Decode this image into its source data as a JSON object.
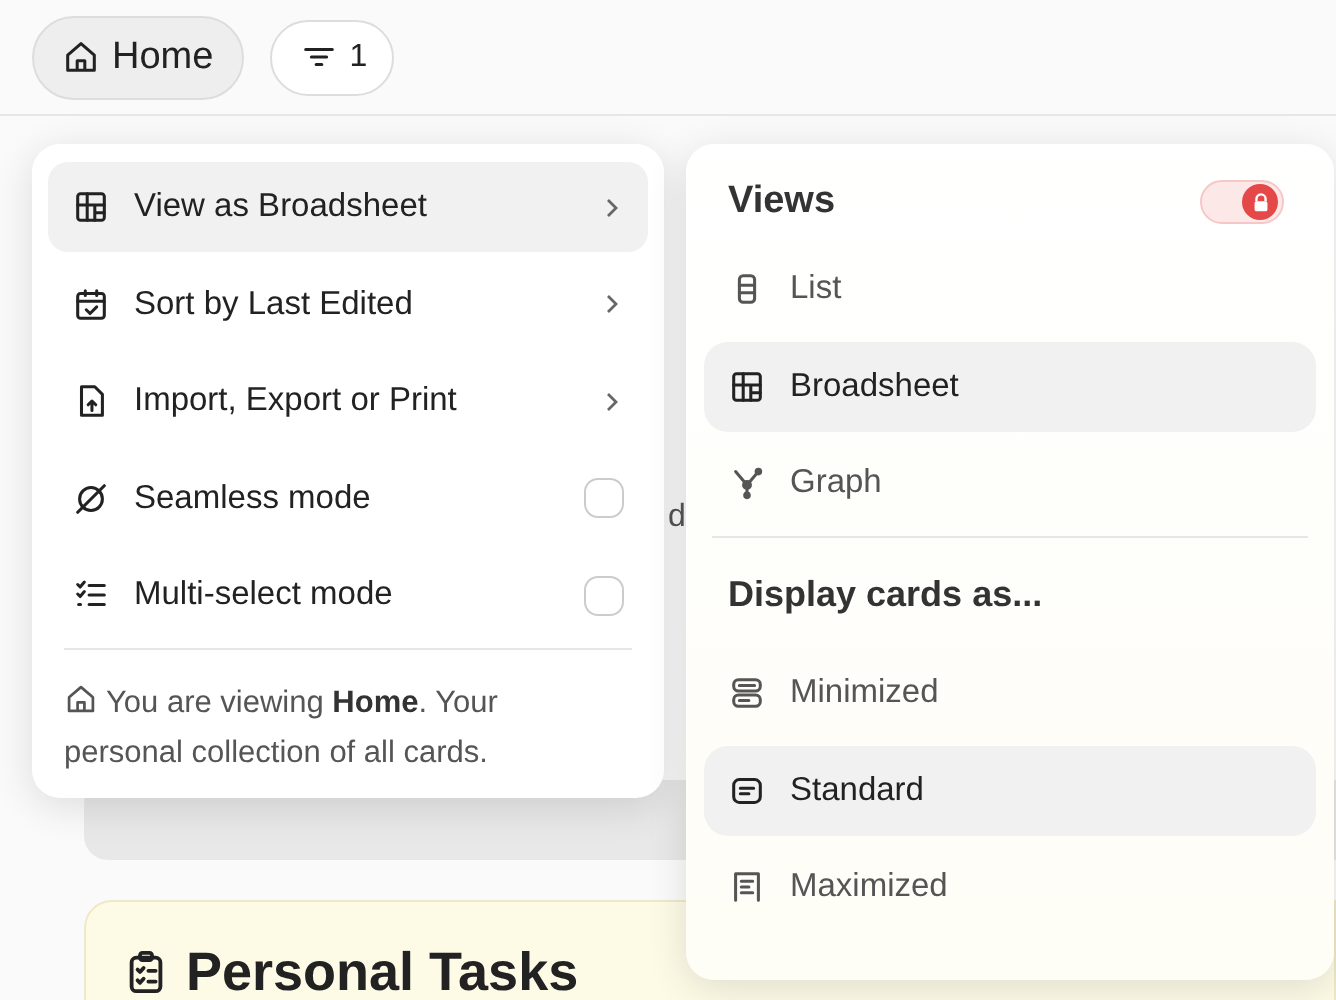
{
  "top_bar": {
    "home_button": {
      "label": "Home"
    },
    "filter_button": {
      "count": "1"
    }
  },
  "background": {
    "fragment": "d",
    "card_title": "Personal Tasks"
  },
  "menu": {
    "items": [
      {
        "kind": "submenu",
        "label": "View as Broadsheet",
        "selected": true
      },
      {
        "kind": "submenu",
        "label": "Sort by Last Edited",
        "selected": false
      },
      {
        "kind": "submenu",
        "label": "Import, Export or Print",
        "selected": false
      },
      {
        "kind": "checkbox",
        "label": "Seamless mode",
        "checked": false
      },
      {
        "kind": "checkbox",
        "label": "Multi-select mode",
        "checked": false
      }
    ],
    "footer": "You are viewing **Home**. Your personal collection of all cards."
  },
  "views_panel": {
    "title": "Views",
    "lock_toggle": {
      "on": true
    },
    "views": [
      {
        "label": "List",
        "selected": false
      },
      {
        "label": "Broadsheet",
        "selected": true
      },
      {
        "label": "Graph",
        "selected": false
      }
    ],
    "display_title": "Display cards as...",
    "display_options": [
      {
        "label": "Minimized",
        "selected": false
      },
      {
        "label": "Standard",
        "selected": true
      },
      {
        "label": "Maximized",
        "selected": false
      }
    ]
  }
}
